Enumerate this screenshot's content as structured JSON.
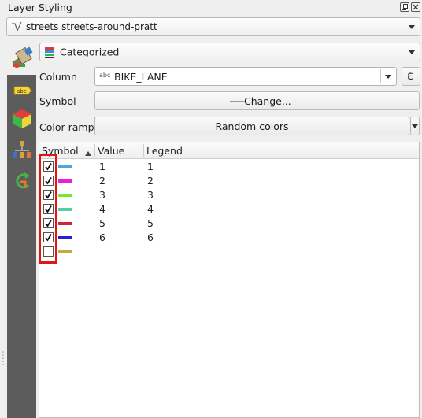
{
  "panel": {
    "title": "Layer Styling"
  },
  "layer_select": {
    "value": "streets streets-around-pratt"
  },
  "renderer_select": {
    "value": "Categorized"
  },
  "form": {
    "column_label": "Column",
    "column_type": "abc",
    "column_value": "BIKE_LANE",
    "expression_glyph": "ε",
    "symbol_label": "Symbol",
    "symbol_button": "Change...",
    "ramp_label": "Color ramp",
    "ramp_value": "Random colors"
  },
  "table": {
    "headers": {
      "symbol": "Symbol",
      "value": "Value",
      "legend": "Legend"
    },
    "rows": [
      {
        "checked": true,
        "color": "#4aa8d8",
        "value": "1",
        "legend": "1"
      },
      {
        "checked": true,
        "color": "#e81ed8",
        "value": "2",
        "legend": "2"
      },
      {
        "checked": true,
        "color": "#74e83a",
        "value": "3",
        "legend": "3"
      },
      {
        "checked": true,
        "color": "#4fd0a8",
        "value": "4",
        "legend": "4"
      },
      {
        "checked": true,
        "color": "#d8203a",
        "value": "5",
        "legend": "5"
      },
      {
        "checked": true,
        "color": "#2a1ed8",
        "value": "6",
        "legend": "6"
      },
      {
        "checked": false,
        "color": "#c8a83a",
        "value": "",
        "legend": ""
      }
    ]
  },
  "colors": {
    "highlight": "#e31414",
    "sidebar": "#5c5c5c"
  },
  "icons": [
    "float-icon",
    "close-icon",
    "line-layer-icon",
    "paint-brush-icon",
    "categorized-icon",
    "labels-icon",
    "3d-view-icon",
    "layer-tree-icon",
    "history-icon",
    "text-type-icon",
    "expression-icon",
    "sort-ascending-icon",
    "checkmark-icon"
  ]
}
